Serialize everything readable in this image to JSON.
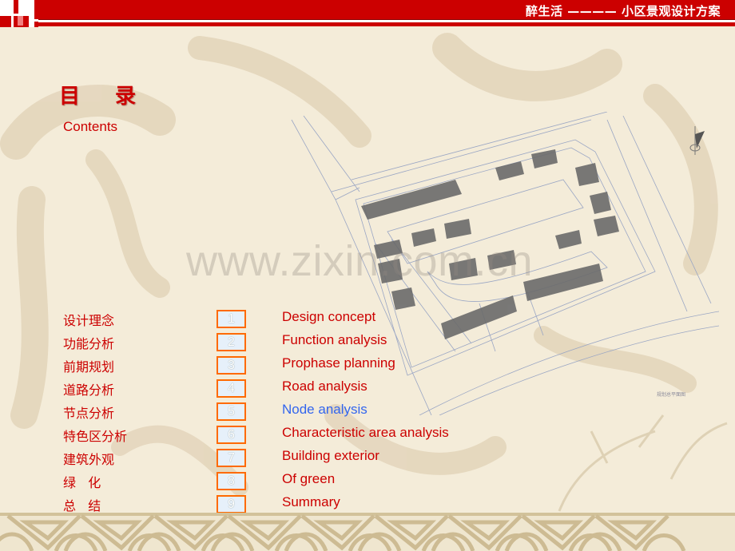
{
  "header": {
    "title": "醉生活 ———— 小区景观设计方案",
    "brand_color": "#cc0000"
  },
  "page": {
    "title_chars": [
      "目",
      "录"
    ],
    "subtitle": "Contents"
  },
  "watermark": "www.zixin.com.cn",
  "plan": {
    "caption": "规划总平面图",
    "north_icon": "north-arrow-icon"
  },
  "toc": {
    "items": [
      {
        "cn": "设计理念",
        "num": "1",
        "en": "Design concept",
        "active": false
      },
      {
        "cn": "功能分析",
        "num": "2",
        "en": "Function analysis",
        "active": false
      },
      {
        "cn": "前期规划",
        "num": "3",
        "en": "Prophase planning",
        "active": false
      },
      {
        "cn": "道路分析",
        "num": "4",
        "en": "Road analysis",
        "active": false
      },
      {
        "cn": "节点分析",
        "num": "5",
        "en": "Node analysis",
        "active": true
      },
      {
        "cn": "特色区分析",
        "num": "6",
        "en": "Characteristic area analysis",
        "active": false
      },
      {
        "cn": "建筑外观",
        "num": "7",
        "en": "Building exterior",
        "active": false
      },
      {
        "cn": "绿   化",
        "num": "8",
        "en": "Of green",
        "active": false
      },
      {
        "cn": "总   结",
        "num": "9",
        "en": "Summary",
        "active": false
      }
    ],
    "text_color": "#cc0000",
    "active_color": "#3366ee",
    "badge_border_color": "#ff6a00"
  }
}
